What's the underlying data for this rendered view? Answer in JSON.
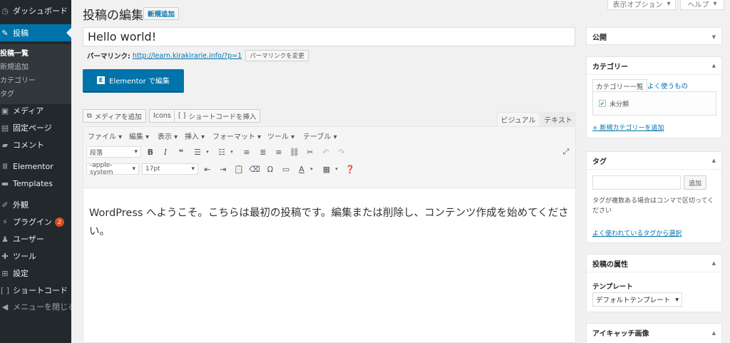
{
  "sidebar": {
    "dashboard": "ダッシュボード",
    "posts": "投稿",
    "posts_sub": [
      "投稿一覧",
      "新規追加",
      "カテゴリー",
      "タグ"
    ],
    "media": "メディア",
    "pages": "固定ページ",
    "comments": "コメント",
    "elementor": "Elementor",
    "templates": "Templates",
    "appearance": "外観",
    "plugins": "プラグイン",
    "plugins_badge": "2",
    "users": "ユーザー",
    "tools": "ツール",
    "settings": "設定",
    "shortcodes": "ショートコード",
    "collapse": "メニューを閉じる"
  },
  "screen_meta": {
    "screen_options": "表示オプション",
    "help": "ヘルプ"
  },
  "header": {
    "title": "投稿の編集",
    "add_new": "新規追加"
  },
  "post": {
    "title": "Hello world!",
    "permalink_label": "パーマリンク:",
    "permalink_url": "http://learn.kirakirarie.info/?p=1",
    "permalink_button": "パーマリンクを変更"
  },
  "elementor_button": "Elementor で編集",
  "editor": {
    "add_media": "メディアを追加",
    "icons": "Icons",
    "insert_shortcode": "ショートコードを挿入",
    "tab_visual": "ビジュアル",
    "tab_text": "テキスト",
    "menubar": [
      "ファイル ▾",
      "編集 ▾",
      "表示 ▾",
      "挿入 ▾",
      "フォーマット ▾",
      "ツール ▾",
      "テーブル ▾"
    ],
    "format_select": "段落",
    "font_family": "-apple-system",
    "font_size": "17pt",
    "content": "WordPress へようこそ。こちらは最初の投稿です。編集または削除し、コンテンツ作成を始めてください。"
  },
  "publish_box": {
    "title": "公開"
  },
  "category_box": {
    "title": "カテゴリー",
    "tab_all": "カテゴリー一覧",
    "tab_popular": "よく使うもの",
    "items": [
      {
        "label": "未分類",
        "checked": true
      }
    ],
    "add_new": "+ 新規カテゴリーを追加"
  },
  "tag_box": {
    "title": "タグ",
    "add_button": "追加",
    "help": "タグが複数ある場合はコンマで区切ってください",
    "popular_link": "よく使われているタグから選択"
  },
  "attributes_box": {
    "title": "投稿の属性",
    "template_label": "テンプレート",
    "template_value": "デフォルトテンプレート"
  },
  "featured_image_box": {
    "title": "アイキャッチ画像"
  },
  "colors": {
    "sidebar_bg": "#23282d",
    "accent": "#0073aa",
    "page_bg": "#f1f1f1",
    "badge": "#d54e21"
  }
}
